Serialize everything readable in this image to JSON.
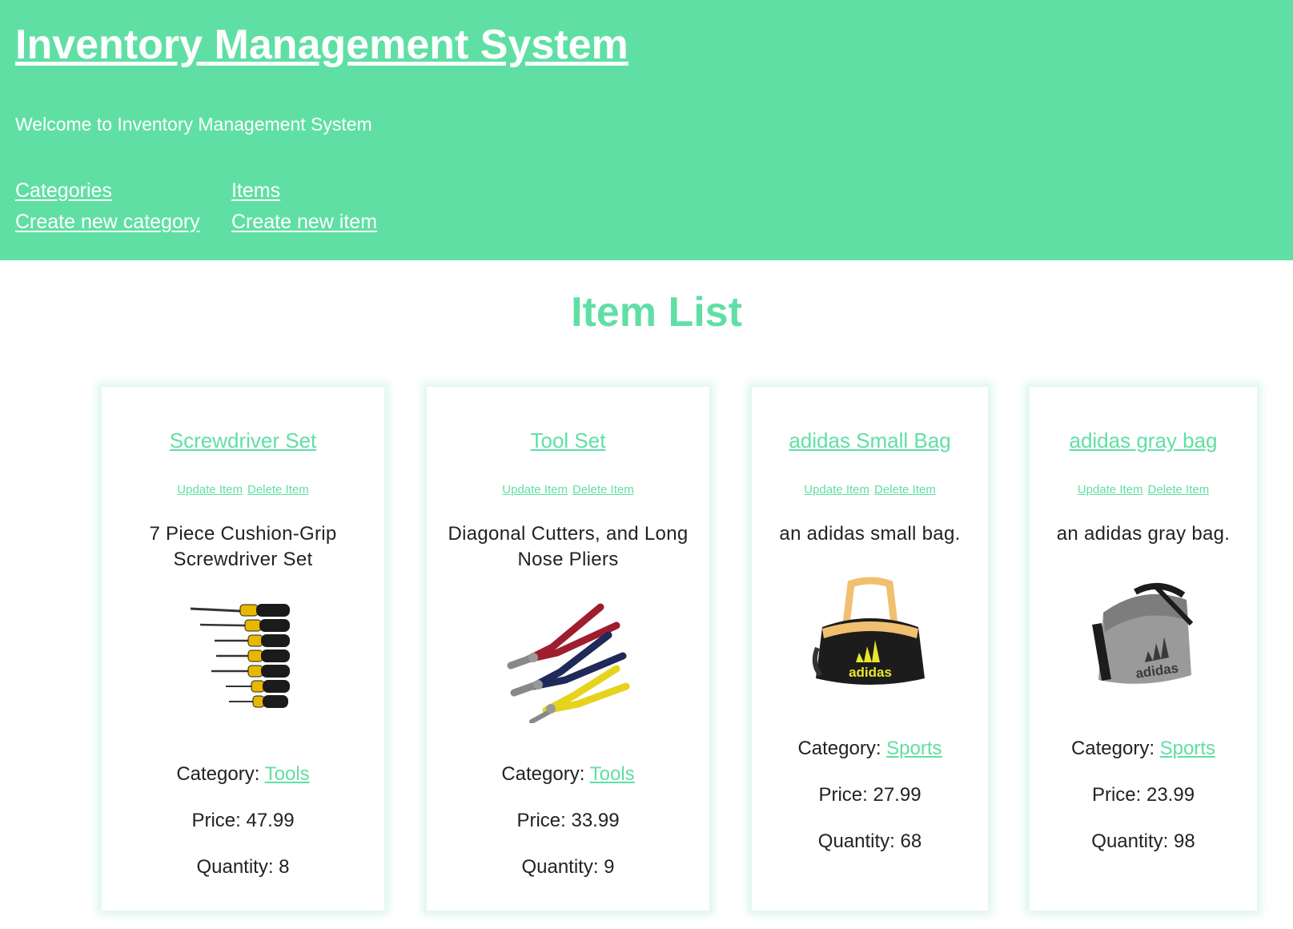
{
  "header": {
    "title": "Inventory Management System",
    "welcome": "Welcome to Inventory Management System",
    "nav": {
      "categories": "Categories",
      "items": "Items",
      "create_category": "Create new category",
      "create_item": "Create new item"
    }
  },
  "main": {
    "heading": "Item List"
  },
  "cards": [
    {
      "name": "Screwdriver Set",
      "update_label": "Update Item",
      "delete_label": "Delete Item",
      "description": "7 Piece Cushion-Grip Screwdriver Set",
      "image": "screwdriver-set-image",
      "category_label": "Category:",
      "category": "Tools",
      "price_label": "Price:",
      "price": "47.99",
      "quantity_label": "Quantity:",
      "quantity": "8"
    },
    {
      "name": "Tool Set",
      "update_label": "Update Item",
      "delete_label": "Delete Item",
      "description": "Diagonal Cutters, and Long Nose Pliers",
      "image": "pliers-set-image",
      "category_label": "Category:",
      "category": "Tools",
      "price_label": "Price:",
      "price": "33.99",
      "quantity_label": "Quantity:",
      "quantity": "9"
    },
    {
      "name": "adidas Small Bag",
      "update_label": "Update Item",
      "delete_label": "Delete Item",
      "description": "an adidas small bag.",
      "image": "black-adidas-bag-image",
      "category_label": "Category:",
      "category": "Sports",
      "price_label": "Price:",
      "price": "27.99",
      "quantity_label": "Quantity:",
      "quantity": "68"
    },
    {
      "name": "adidas gray bag",
      "update_label": "Update Item",
      "delete_label": "Delete Item",
      "description": "an adidas gray bag.",
      "image": "gray-adidas-bag-image",
      "category_label": "Category:",
      "category": "Sports",
      "price_label": "Price:",
      "price": "23.99",
      "quantity_label": "Quantity:",
      "quantity": "98"
    }
  ],
  "colors": {
    "accent": "#60DFA4",
    "text": "#222222",
    "header_text": "#ffffff"
  },
  "images": {
    "bag_logo_text": "adidas"
  }
}
